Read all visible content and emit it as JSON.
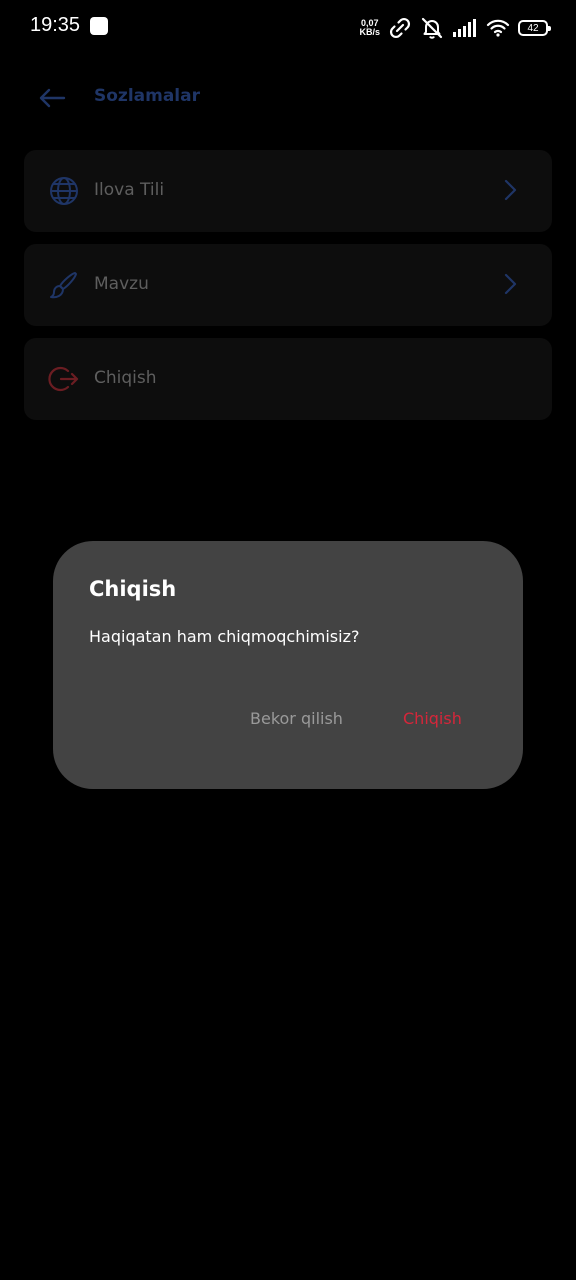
{
  "status_bar": {
    "time": "19:35",
    "net_speed_value": "0,07",
    "net_speed_unit": "KB/s",
    "battery": "42"
  },
  "header": {
    "title": "Sozlamalar"
  },
  "menu": {
    "items": [
      {
        "label": "Ilova Tili",
        "icon": "globe-icon"
      },
      {
        "label": "Mavzu",
        "icon": "brush-icon"
      },
      {
        "label": "Chiqish",
        "icon": "logout-icon"
      }
    ]
  },
  "dialog": {
    "title": "Chiqish",
    "message": "Haqiqatan ham chiqmoqchimisiz?",
    "cancel_label": "Bekor qilish",
    "confirm_label": "Chiqish"
  },
  "colors": {
    "background": "#000000",
    "dialog_bg": "#434343",
    "accent_blue": "#1f3566",
    "danger_red": "#d5263a"
  }
}
